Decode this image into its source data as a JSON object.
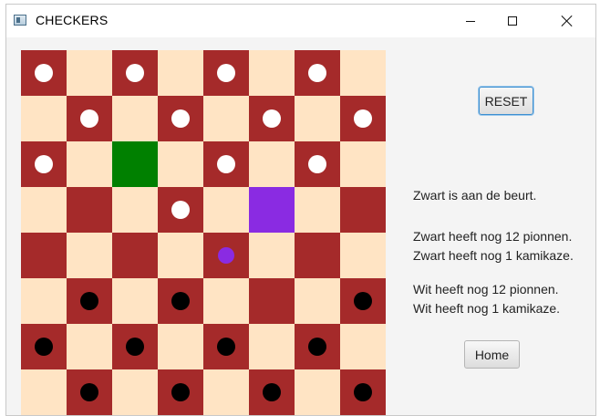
{
  "window": {
    "title": "CHECKERS",
    "controls": [
      "minimize",
      "maximize",
      "close"
    ]
  },
  "board": {
    "size": 8,
    "colors": {
      "light": "#ffe4c4",
      "dark": "#a52a2a",
      "selected": "#008000",
      "target": "#8a2be2",
      "white_piece": "#ffffff",
      "black_piece": "#000000",
      "kamikaze_piece": "#8a2be2"
    },
    "highlights": {
      "selected": [
        2,
        2
      ],
      "target": [
        3,
        5
      ]
    },
    "pieces": [
      {
        "row": 0,
        "col": 0,
        "color": "white"
      },
      {
        "row": 0,
        "col": 2,
        "color": "white"
      },
      {
        "row": 0,
        "col": 4,
        "color": "white"
      },
      {
        "row": 0,
        "col": 6,
        "color": "white"
      },
      {
        "row": 1,
        "col": 1,
        "color": "white"
      },
      {
        "row": 1,
        "col": 3,
        "color": "white"
      },
      {
        "row": 1,
        "col": 5,
        "color": "white"
      },
      {
        "row": 1,
        "col": 7,
        "color": "white"
      },
      {
        "row": 2,
        "col": 0,
        "color": "white"
      },
      {
        "row": 2,
        "col": 4,
        "color": "white"
      },
      {
        "row": 2,
        "col": 6,
        "color": "white"
      },
      {
        "row": 3,
        "col": 3,
        "color": "white"
      },
      {
        "row": 4,
        "col": 4,
        "color": "purple",
        "kind": "kamikaze"
      },
      {
        "row": 5,
        "col": 1,
        "color": "black"
      },
      {
        "row": 5,
        "col": 3,
        "color": "black"
      },
      {
        "row": 5,
        "col": 7,
        "color": "black"
      },
      {
        "row": 6,
        "col": 0,
        "color": "black"
      },
      {
        "row": 6,
        "col": 2,
        "color": "black"
      },
      {
        "row": 6,
        "col": 4,
        "color": "black"
      },
      {
        "row": 6,
        "col": 6,
        "color": "black"
      },
      {
        "row": 7,
        "col": 1,
        "color": "black"
      },
      {
        "row": 7,
        "col": 3,
        "color": "black"
      },
      {
        "row": 7,
        "col": 5,
        "color": "black"
      },
      {
        "row": 7,
        "col": 7,
        "color": "black"
      }
    ]
  },
  "controls": {
    "reset_label": "RESET",
    "home_label": "Home"
  },
  "status": {
    "turn": "Zwart is aan de beurt.",
    "black_pieces": "Zwart heeft nog 12 pionnen.",
    "black_kamikaze": "Zwart heeft nog 1 kamikaze.",
    "white_pieces": "Wit heeft nog 12 pionnen.",
    "white_kamikaze": "Wit heeft nog 1 kamikaze."
  }
}
